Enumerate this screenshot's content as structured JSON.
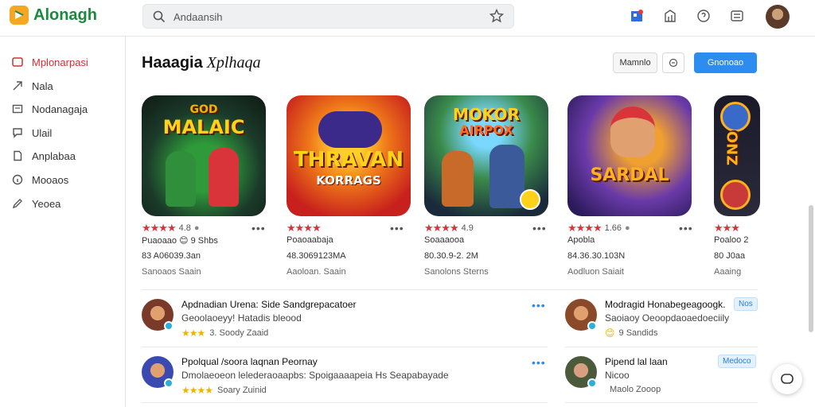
{
  "app": {
    "name": "Alonagh",
    "brand_color": "#1a8a3a",
    "accent": "#2c8cf0"
  },
  "search": {
    "value": "Andaansih",
    "placeholder": "Andaansih"
  },
  "sidebar": {
    "items": [
      {
        "label": "Mplonarpasi",
        "icon": "tag-icon",
        "active": true
      },
      {
        "label": "Nala",
        "icon": "arrow-icon",
        "active": false
      },
      {
        "label": "Nodanagaja",
        "icon": "box-icon",
        "active": false
      },
      {
        "label": "Ulail",
        "icon": "chat-icon",
        "active": false
      },
      {
        "label": "Anplabaa",
        "icon": "doc-icon",
        "active": false
      },
      {
        "label": "Mooaos",
        "icon": "info-icon",
        "active": false
      },
      {
        "label": "Yeoea",
        "icon": "pen-icon",
        "active": false
      }
    ]
  },
  "main": {
    "title": "Haaagia",
    "title_sub": "Xplhaqa",
    "filter_label": "Mamnlo",
    "primary_label": "Gnonoao"
  },
  "cards": [
    {
      "art_text": "MALAIC",
      "art_top": "GOD",
      "rating_label": "4.8",
      "line1": "Puaoaao 😊 9 Shbs",
      "line2": "83 A06039.3an",
      "line3": "Sanoaos Saain"
    },
    {
      "art_text": "THRAVAN",
      "art_top": "KORRAGS",
      "rating_label": "",
      "line1": "Poaoaabaja",
      "line2": "48.3069123MA",
      "line3": "Aaoloan. Saain"
    },
    {
      "art_text": "MOKOR",
      "art_top": "AIRPOX",
      "rating_label": "4.9",
      "line1": "Soaaaooa",
      "line2": "80.30.9-2. 2M",
      "line3": "Sanolons Sterns"
    },
    {
      "art_text": "SARDAL",
      "art_top": "",
      "rating_label": "1.66",
      "line1": "Apobla",
      "line2": "84.36.30.103N",
      "line3": "Aodluon Saiait"
    },
    {
      "art_text": "ZNO",
      "art_top": "",
      "rating_label": "",
      "line1": "Poaloo 2",
      "line2": "80 J0aa",
      "line3": "Aaaing"
    }
  ],
  "list": [
    {
      "title": "Apdnadian Urena: Side  Sandgrepacatoer",
      "desc": "Geoolaoeyy! Hatadis bleood",
      "meta": "3.  Soody   Zaaid",
      "stars": "★★★"
    },
    {
      "title": "Modragid Honabegeagoogk.",
      "desc": "Saoiaoy  Oeoopdaoaedoeciily",
      "meta": "9  Sandids",
      "stars": "😊",
      "tag": "Nos"
    },
    {
      "title": "Ppolqual /soora laqnan Peornay",
      "desc": "Dmolaeoeon lelederaoaapbs: Spoigaaaapeia Hs Seapabayade",
      "meta": "Soary   Zuinid",
      "stars": "★★★★"
    },
    {
      "title": "Pipend lal laan",
      "desc": "Nicoo",
      "meta": "Maolo  Zooop",
      "stars": "",
      "tag": "Medoco"
    }
  ]
}
